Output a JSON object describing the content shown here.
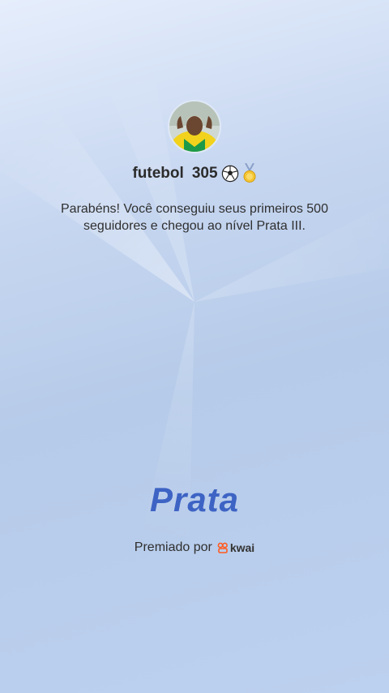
{
  "profile": {
    "username": "futebol",
    "score": "305",
    "ball_icon": "soccer-ball-icon",
    "medal_icon": "medal-icon"
  },
  "message": "Parabéns! Você conseguiu seus primeiros 500 seguidores e chegou ao nível Prata III.",
  "level": {
    "name": "Prata",
    "color": "#3d63c4"
  },
  "award": {
    "label": "Premiado por",
    "brand": "kwai",
    "brand_color": "#ff5a1f"
  }
}
